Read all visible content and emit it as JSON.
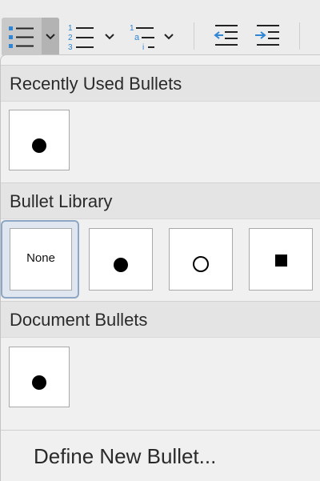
{
  "toolbar": {
    "bullets_button": {
      "icon": "bulleted-list-icon",
      "dropdown_icon": "chevron-down-icon"
    },
    "numbering_button": {
      "icon": "numbered-list-icon",
      "dropdown_icon": "chevron-down-icon",
      "glyphs": [
        "1",
        "2",
        "3"
      ]
    },
    "multilevel_button": {
      "icon": "multilevel-list-icon",
      "dropdown_icon": "chevron-down-icon",
      "glyphs": [
        "1",
        "a",
        "i"
      ]
    },
    "decrease_indent_button": {
      "icon": "decrease-indent-icon"
    },
    "increase_indent_button": {
      "icon": "increase-indent-icon"
    },
    "accent_color": "#2f86d4"
  },
  "menu": {
    "sections": {
      "recent": {
        "title": "Recently Used Bullets"
      },
      "library": {
        "title": "Bullet Library"
      },
      "document": {
        "title": "Document Bullets"
      }
    },
    "recent_items": [
      {
        "type": "filled-circle"
      }
    ],
    "library_items": [
      {
        "type": "none",
        "label": "None",
        "selected": true
      },
      {
        "type": "filled-circle"
      },
      {
        "type": "hollow-circle"
      },
      {
        "type": "filled-square"
      }
    ],
    "document_items": [
      {
        "type": "filled-circle"
      }
    ],
    "define_new_bullet": "Define New Bullet..."
  }
}
